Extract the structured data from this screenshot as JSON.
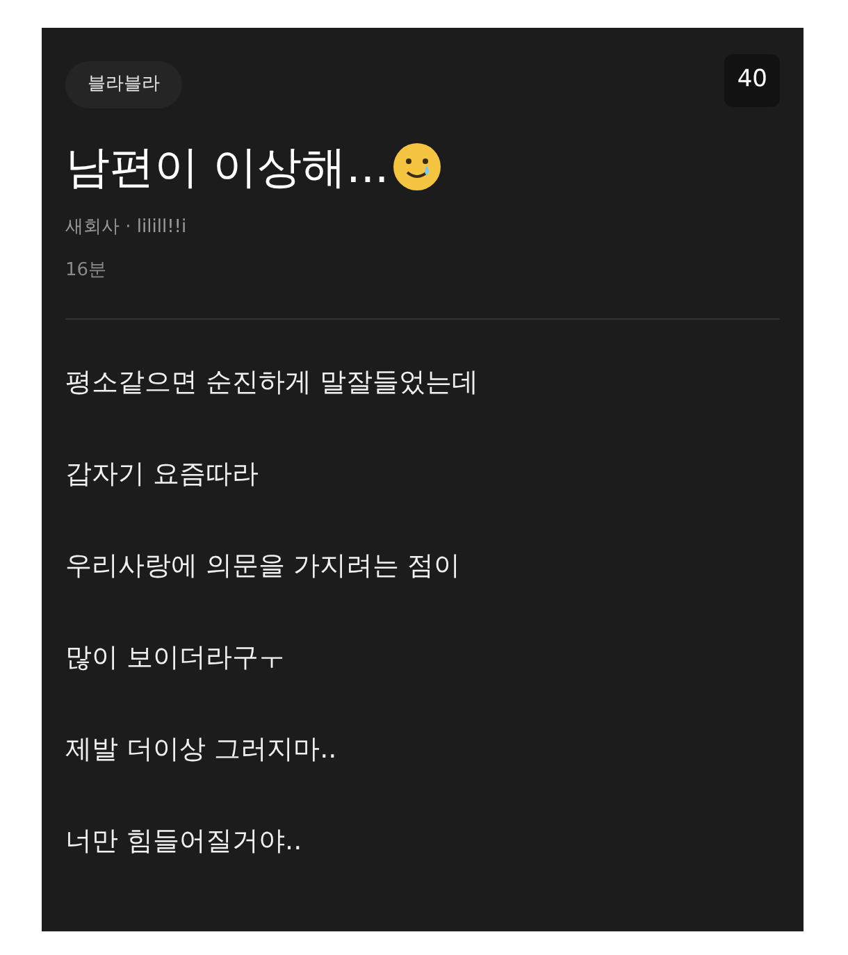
{
  "category_tag": "블라블라",
  "count_badge": "40",
  "title": "남편이 이상해...",
  "author": {
    "company": "새회사",
    "separator": "·",
    "nickname": "lilill!!i"
  },
  "time": "16분",
  "body_lines": [
    "평소같으면 순진하게 말잘들었는데",
    "갑자기 요즘따라",
    "우리사랑에 의문을 가지려는 점이",
    "많이 보이더라구ㅜ",
    "제발 더이상 그러지마..",
    "너만 힘들어질거야.."
  ]
}
